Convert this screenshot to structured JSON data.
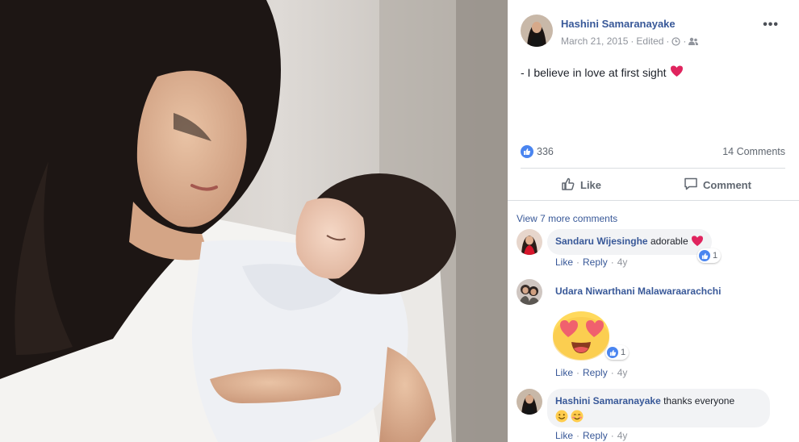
{
  "post": {
    "author": "Hashini Samaranayake",
    "date": "March 21, 2015",
    "edited": "Edited",
    "text": "- I believe in love at first sight",
    "reaction_count": "336",
    "comments_count": "14 Comments"
  },
  "actions": {
    "like_label": "Like",
    "comment_label": "Comment"
  },
  "view_more": "View 7 more comments",
  "comments": [
    {
      "author": "Sandaru Wijesinghe",
      "text": "adorable",
      "like": "Like",
      "reply": "Reply",
      "time": "4y",
      "reactions": "1"
    },
    {
      "author": "Udara Niwarthani Malawaraarachchi",
      "text": "",
      "like": "Like",
      "reply": "Reply",
      "time": "4y",
      "reactions": "1"
    },
    {
      "author": "Hashini Samaranayake",
      "text": "thanks everyone",
      "like": "Like",
      "reply": "Reply",
      "time": "4y",
      "reactions": ""
    }
  ],
  "separator": "·",
  "colors": {
    "link": "#385898",
    "like_blue": "#4a85f0",
    "heart": "#e0245e",
    "bubble": "#f2f3f5"
  },
  "icons": [
    "clock-icon",
    "friends-icon",
    "more-options-icon",
    "like-reaction-icon",
    "thumbs-up-icon",
    "comment-icon",
    "heart-icon",
    "heart-eyes-emoji",
    "smile-emoji",
    "blush-emoji"
  ]
}
